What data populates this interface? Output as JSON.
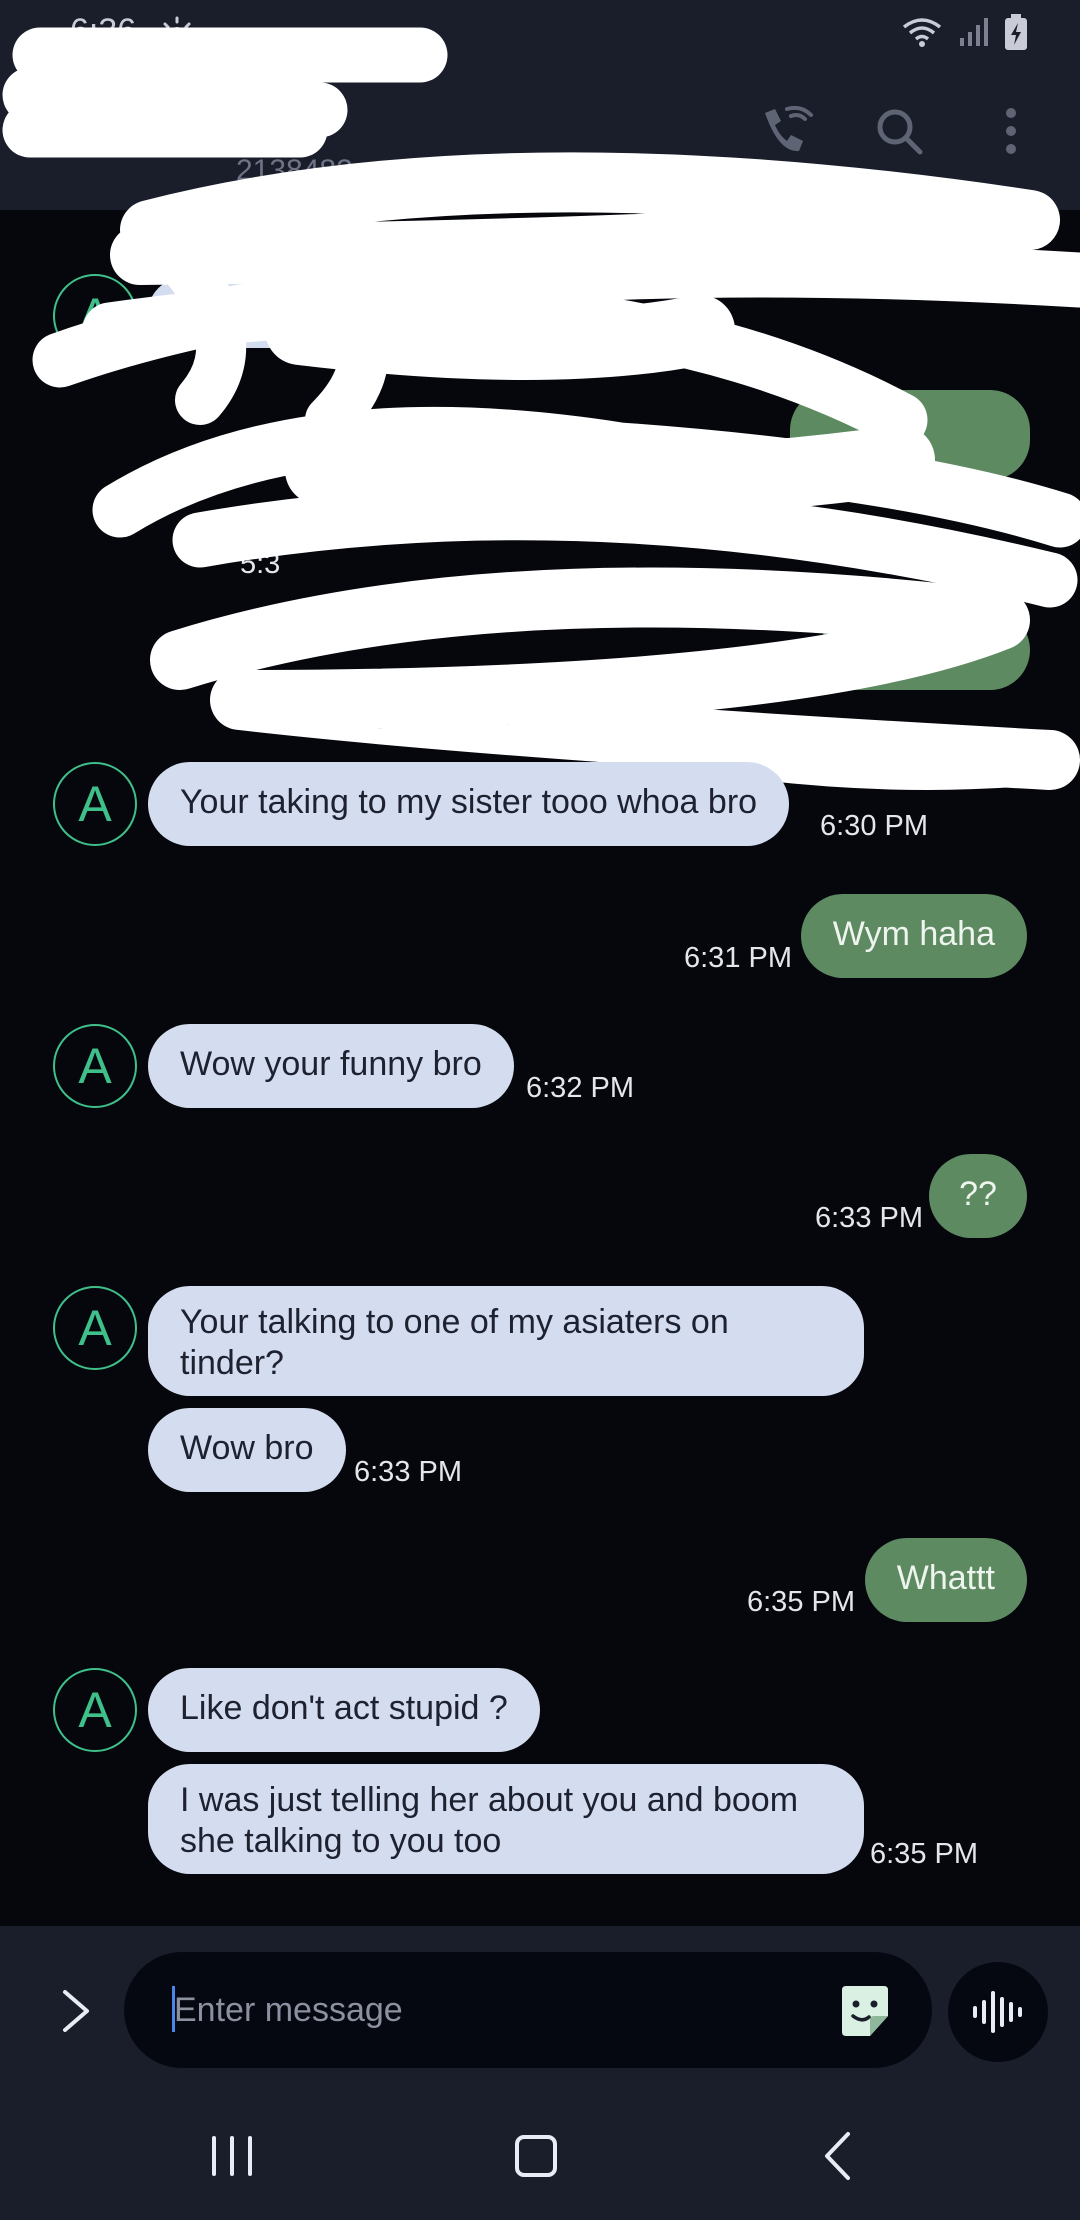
{
  "status_bar": {
    "time": "6:36",
    "icons": [
      "weather-sun-icon",
      "wifi-icon",
      "signal-icon",
      "battery-charging-icon"
    ]
  },
  "header": {
    "contact_name": "",
    "contact_subtitle": "2138482",
    "icons": [
      "wifi-call-icon",
      "search-icon",
      "more-options-icon"
    ]
  },
  "conversation": {
    "redacted_timestamp": "5:3",
    "messages": [
      {
        "direction": "in",
        "avatar": "A",
        "text": "Your taking to my sister tooo whoa bro",
        "time": "6:30 PM"
      },
      {
        "direction": "out",
        "text": "Wym haha",
        "time": "6:31 PM"
      },
      {
        "direction": "in",
        "avatar": "A",
        "text": "Wow your funny bro",
        "time": "6:32 PM"
      },
      {
        "direction": "out",
        "text": "??",
        "time": "6:33 PM"
      },
      {
        "direction": "in",
        "avatar": "A",
        "text": "Your talking to one of my asiaters on tinder?",
        "time": ""
      },
      {
        "direction": "in",
        "text": "Wow bro",
        "time": "6:33 PM"
      },
      {
        "direction": "out",
        "text": "Whattt",
        "time": "6:35 PM"
      },
      {
        "direction": "in",
        "avatar": "A",
        "text": "Like don't act stupid ?",
        "time": ""
      },
      {
        "direction": "in",
        "text": "I was just telling her about you and boom she talking to you too",
        "time": "6:35 PM"
      }
    ]
  },
  "compose": {
    "placeholder": "Enter message",
    "value": "",
    "icons": [
      "expand-icon",
      "sticker-icon",
      "voice-input-icon"
    ]
  },
  "nav_bar": {
    "icons": [
      "recents-icon",
      "home-icon",
      "back-icon"
    ]
  },
  "colors": {
    "background": "#05070c",
    "bar": "#1a1e2b",
    "incoming_bubble": "#d4ddf0",
    "outgoing_bubble": "#5e8a62",
    "avatar_accent": "#3fbf8a"
  }
}
